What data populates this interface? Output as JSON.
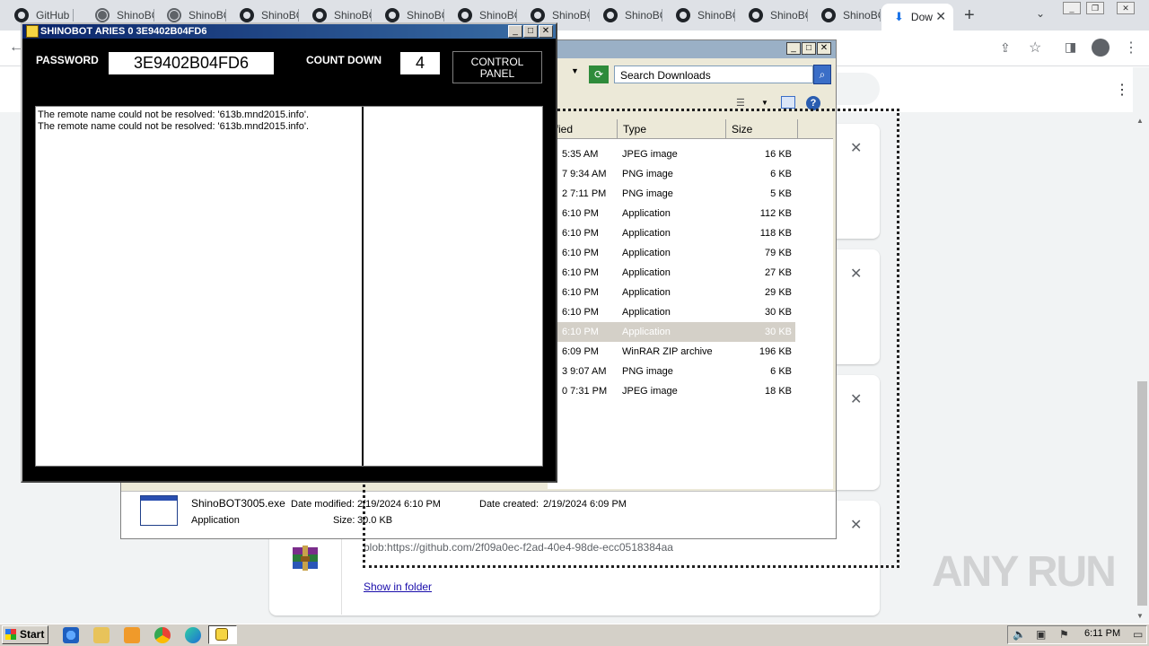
{
  "browser": {
    "tabs": [
      {
        "label": "GitHub -",
        "icon": "github-icon"
      },
      {
        "label": "ShinoBO",
        "icon": "globe-icon"
      },
      {
        "label": "ShinoBO",
        "icon": "globe-icon"
      },
      {
        "label": "ShinoBO",
        "icon": "github-icon"
      },
      {
        "label": "ShinoBO",
        "icon": "github-icon"
      },
      {
        "label": "ShinoBO",
        "icon": "github-icon"
      },
      {
        "label": "ShinoBO",
        "icon": "github-icon"
      },
      {
        "label": "ShinoBO",
        "icon": "github-icon"
      },
      {
        "label": "ShinoBO",
        "icon": "github-icon"
      },
      {
        "label": "ShinoBO",
        "icon": "github-icon"
      },
      {
        "label": "ShinoBO",
        "icon": "github-icon"
      },
      {
        "label": "ShinoBO",
        "icon": "github-icon"
      }
    ],
    "active_tab": {
      "label": "Dow",
      "icon": "download-icon"
    },
    "new_tab_symbol": "+",
    "tab_search_symbol": "⌄",
    "menu_symbol": "⋮"
  },
  "downloads_page": {
    "blob_url": "blob:https://github.com/2f09a0ec-f2ad-40e4-98de-ecc0518384aa",
    "show_in_folder": "Show in folder",
    "close_symbol": "✕"
  },
  "explorer": {
    "search_placeholder": "Search Downloads",
    "columns": [
      "ified",
      "Type",
      "Size"
    ],
    "files": [
      {
        "modified": "5:35 AM",
        "type": "JPEG image",
        "size": "16 KB"
      },
      {
        "modified": "7 9:34 AM",
        "type": "PNG image",
        "size": "6 KB"
      },
      {
        "modified": "2 7:11 PM",
        "type": "PNG image",
        "size": "5 KB"
      },
      {
        "modified": "6:10 PM",
        "type": "Application",
        "size": "112 KB"
      },
      {
        "modified": "6:10 PM",
        "type": "Application",
        "size": "118 KB"
      },
      {
        "modified": "6:10 PM",
        "type": "Application",
        "size": "79 KB"
      },
      {
        "modified": "6:10 PM",
        "type": "Application",
        "size": "27 KB"
      },
      {
        "modified": "6:10 PM",
        "type": "Application",
        "size": "29 KB"
      },
      {
        "modified": "6:10 PM",
        "type": "Application",
        "size": "30 KB"
      },
      {
        "modified": "6:10 PM",
        "type": "Application",
        "size": "30 KB",
        "selected": true
      },
      {
        "modified": "6:09 PM",
        "type": "WinRAR ZIP archive",
        "size": "196 KB"
      },
      {
        "modified": "3 9:07 AM",
        "type": "PNG image",
        "size": "6 KB"
      },
      {
        "modified": "0 7:31 PM",
        "type": "JPEG image",
        "size": "18 KB"
      }
    ],
    "details": {
      "filename": "ShinoBOT3005.exe",
      "filetype": "Application",
      "modified_label": "Date modified:",
      "modified_value": "2/19/2024 6:10 PM",
      "created_label": "Date created:",
      "created_value": "2/19/2024 6:09 PM",
      "size_label": "Size:",
      "size_value": "30.0 KB"
    }
  },
  "shinobot": {
    "title": "SHINOBOT ARIES 0 3E9402B04FD6",
    "password_label": "PASSWORD",
    "password_value": "3E9402B04FD6",
    "countdown_label": "COUNT DOWN",
    "countdown_value": "4",
    "control_panel": "CONTROL\nPANEL",
    "log_lines": [
      "The remote name could not be resolved: '613b.mnd2015.info'.",
      "The remote name could not be resolved: '613b.mnd2015.info'."
    ]
  },
  "taskbar": {
    "start_label": "Start",
    "clock": "6:11 PM"
  },
  "watermark": "ANY RUN"
}
